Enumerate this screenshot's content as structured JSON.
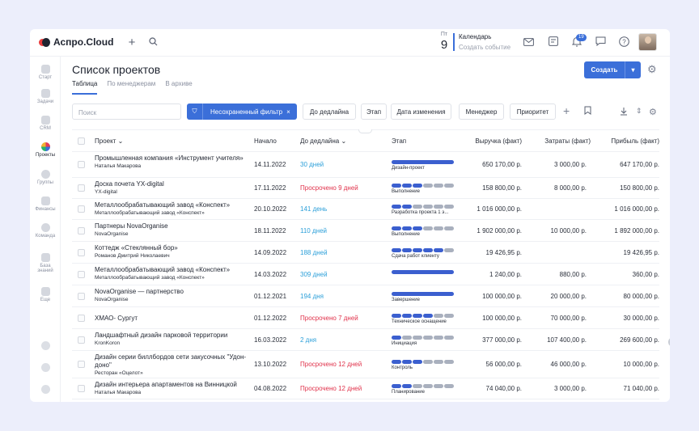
{
  "app": {
    "logo": "Аспро.Cloud"
  },
  "topbar": {
    "cal_weekday": "Пт",
    "cal_day": "9",
    "cal_title": "Календарь",
    "cal_sub": "Создать событие",
    "notif_count": "19"
  },
  "sidebar": {
    "items": [
      {
        "label": "Старт"
      },
      {
        "label": "Задачи"
      },
      {
        "label": "CRM"
      },
      {
        "label": "Проекты"
      },
      {
        "label": "Группы"
      },
      {
        "label": "Финансы"
      },
      {
        "label": "Команда"
      },
      {
        "label": "База знаний"
      },
      {
        "label": "Еще"
      }
    ]
  },
  "page": {
    "title": "Список проектов",
    "tabs": [
      {
        "label": "Таблица"
      },
      {
        "label": "По менеджерам"
      },
      {
        "label": "В архиве"
      }
    ],
    "create_label": "Создать"
  },
  "toolbar": {
    "search_placeholder": "Поиск",
    "filter_label": "Несохраненный фильтр",
    "chips": [
      "До дедлайна",
      "Этап",
      "Дата изменения",
      "Менеджер",
      "Приоритет"
    ]
  },
  "table": {
    "headers": {
      "project": "Проект",
      "start": "Начало",
      "deadline": "До дедлайна",
      "stage": "Этап",
      "revenue": "Выручка (факт)",
      "costs": "Затраты (факт)",
      "profit": "Прибыль (факт)"
    },
    "colors": {
      "done": "#3b5fcf",
      "todo": "#a9b0be"
    },
    "rows": [
      {
        "name": "Промышленная компания «Инструмент учителя»",
        "sub": "Наталья Макарова",
        "start": "14.11.2022",
        "deadline": "30 дней",
        "late": false,
        "stage": "Дизайн-проект",
        "progress": 1.0,
        "revenue": "650 170,00 р.",
        "costs": "3 000,00 р.",
        "profit": "647 170,00 р."
      },
      {
        "name": "Доска почета YX-digital",
        "sub": "YX-digital",
        "start": "17.11.2022",
        "deadline": "Просрочено 9 дней",
        "late": true,
        "stage": "Выполнение",
        "progress": 0.5,
        "revenue": "158 800,00 р.",
        "costs": "8 000,00 р.",
        "profit": "150 800,00 р."
      },
      {
        "name": "Металлообрабатывающий завод «Конспект»",
        "sub": "Металлообрабатывающий завод «Конспект»",
        "start": "20.10.2022",
        "deadline": "141 день",
        "late": false,
        "stage": "Разработка проекта 1 э...",
        "progress": 0.25,
        "revenue": "1 016 000,00 р.",
        "costs": "",
        "profit": "1 016 000,00 р."
      },
      {
        "name": "Партнеры NovaOrganise",
        "sub": "NovaOrganise",
        "start": "18.11.2022",
        "deadline": "110 дней",
        "late": false,
        "stage": "Выполнение",
        "progress": 0.5,
        "revenue": "1 902 000,00 р.",
        "costs": "10 000,00 р.",
        "profit": "1 892 000,00 р."
      },
      {
        "name": "Коттедж «Стеклянный бор»",
        "sub": "Романов Дмитрий Николаевич",
        "start": "14.09.2022",
        "deadline": "188 дней",
        "late": false,
        "stage": "Сдача работ клиенту",
        "progress": 0.83,
        "revenue": "19 426,95 р.",
        "costs": "",
        "profit": "19 426,95 р."
      },
      {
        "name": "Металлообрабатывающий завод «Конспект»",
        "sub": "Металлообрабатывающий завод «Конспект»",
        "start": "14.03.2022",
        "deadline": "309 дней",
        "late": false,
        "stage": "",
        "progress": 1.0,
        "revenue": "1 240,00 р.",
        "costs": "880,00 р.",
        "profit": "360,00 р."
      },
      {
        "name": "NovaOrganise — партнерство",
        "sub": "NovaOrganise",
        "start": "01.12.2021",
        "deadline": "194 дня",
        "late": false,
        "stage": "Завершение",
        "progress": 1.0,
        "revenue": "100 000,00 р.",
        "costs": "20 000,00 р.",
        "profit": "80 000,00 р."
      },
      {
        "name": "ХМАО- Сургут",
        "sub": "",
        "start": "01.12.2022",
        "deadline": "Просрочено 7 дней",
        "late": true,
        "stage": "Техническое оснащение",
        "progress": 0.67,
        "revenue": "100 000,00 р.",
        "costs": "70 000,00 р.",
        "profit": "30 000,00 р."
      },
      {
        "name": "Ландшафтный дизайн парковой территории",
        "sub": "KronKoron",
        "start": "16.03.2022",
        "deadline": "2 дня",
        "late": false,
        "stage": "Инициация",
        "progress": 0.17,
        "revenue": "377 000,00 р.",
        "costs": "107 400,00 р.",
        "profit": "269 600,00 р."
      },
      {
        "name": "Дизайн серии биллбордов сети закусочных \"Удон-доно\"",
        "sub": "Ресторан «Оцелот»",
        "start": "13.10.2022",
        "deadline": "Просрочено 12 дней",
        "late": true,
        "stage": "Контроль",
        "progress": 0.5,
        "revenue": "56 000,00 р.",
        "costs": "46 000,00 р.",
        "profit": "10 000,00 р."
      },
      {
        "name": "Дизайн интерьера апартаментов на Винницкой",
        "sub": "Наталья Макарова",
        "start": "04.08.2022",
        "deadline": "Просрочено 12 дней",
        "late": true,
        "stage": "Планирование",
        "progress": 0.33,
        "revenue": "74 040,00 р.",
        "costs": "3 000,00 р.",
        "profit": "71 040,00 р."
      }
    ]
  }
}
